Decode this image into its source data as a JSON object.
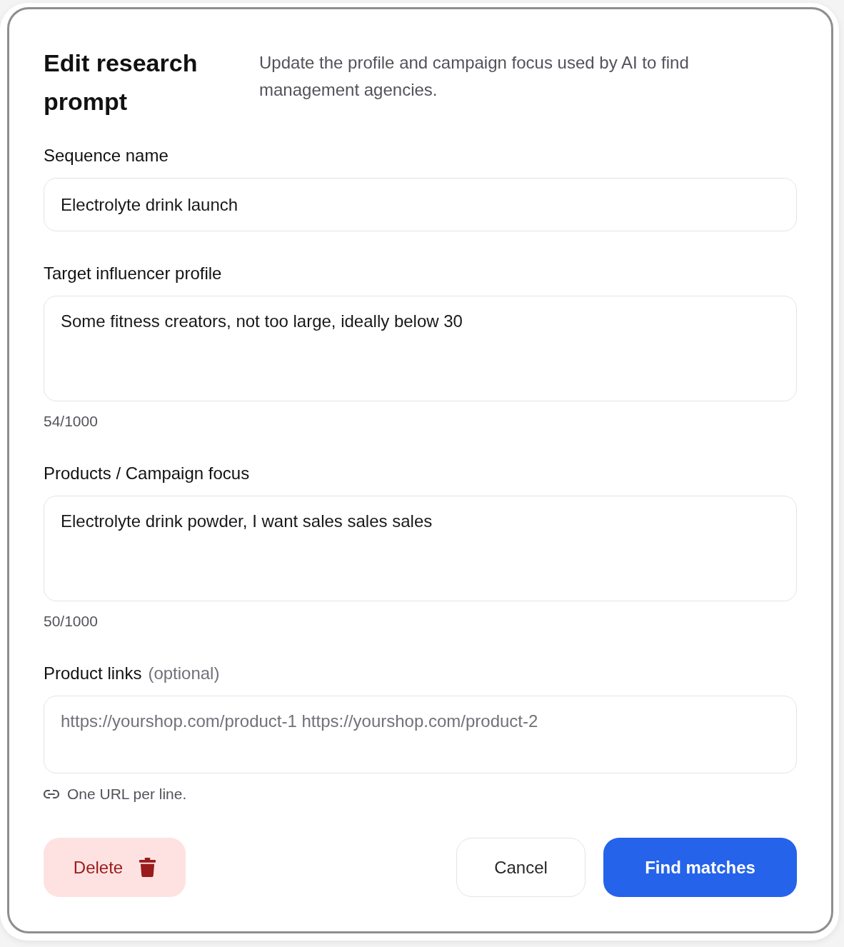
{
  "dialog": {
    "title": "Edit research prompt",
    "description": "Update the profile and campaign focus used by AI to find management agencies.",
    "fields": [
      {
        "kind": "input",
        "label": "Sequence name",
        "value": "Electrolyte drink launch"
      },
      {
        "kind": "textarea",
        "label": "Target influencer profile",
        "value": "Some fitness creators, not too large, ideally below 30",
        "counter": "54/1000"
      },
      {
        "kind": "textarea",
        "label": "Products / Campaign focus",
        "value": "Electrolyte drink powder, I want sales sales sales",
        "counter": "50/1000"
      },
      {
        "kind": "links",
        "label": "Product links",
        "label_note": "(optional)",
        "placeholder": "https://yourshop.com/product-1 https://yourshop.com/product-2",
        "hint": "One URL per line."
      }
    ],
    "buttons": [
      {
        "kind": "danger",
        "label": "Delete"
      },
      {
        "kind": "secondary",
        "label": "Cancel"
      },
      {
        "kind": "primary",
        "label": "Find matches"
      }
    ]
  }
}
